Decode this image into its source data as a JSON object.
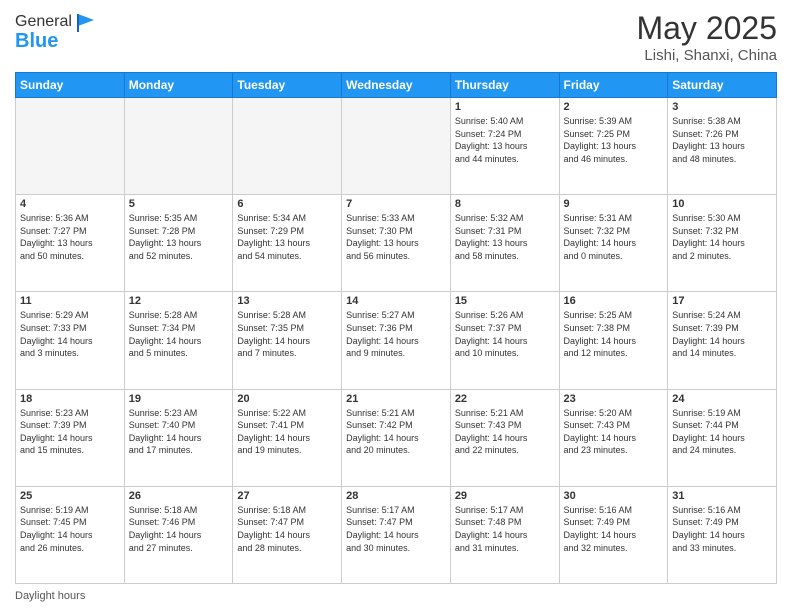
{
  "header": {
    "logo_general": "General",
    "logo_blue": "Blue",
    "month_title": "May 2025",
    "location": "Lishi, Shanxi, China"
  },
  "weekdays": [
    "Sunday",
    "Monday",
    "Tuesday",
    "Wednesday",
    "Thursday",
    "Friday",
    "Saturday"
  ],
  "weeks": [
    [
      {
        "day": "",
        "info": ""
      },
      {
        "day": "",
        "info": ""
      },
      {
        "day": "",
        "info": ""
      },
      {
        "day": "",
        "info": ""
      },
      {
        "day": "1",
        "info": "Sunrise: 5:40 AM\nSunset: 7:24 PM\nDaylight: 13 hours\nand 44 minutes."
      },
      {
        "day": "2",
        "info": "Sunrise: 5:39 AM\nSunset: 7:25 PM\nDaylight: 13 hours\nand 46 minutes."
      },
      {
        "day": "3",
        "info": "Sunrise: 5:38 AM\nSunset: 7:26 PM\nDaylight: 13 hours\nand 48 minutes."
      }
    ],
    [
      {
        "day": "4",
        "info": "Sunrise: 5:36 AM\nSunset: 7:27 PM\nDaylight: 13 hours\nand 50 minutes."
      },
      {
        "day": "5",
        "info": "Sunrise: 5:35 AM\nSunset: 7:28 PM\nDaylight: 13 hours\nand 52 minutes."
      },
      {
        "day": "6",
        "info": "Sunrise: 5:34 AM\nSunset: 7:29 PM\nDaylight: 13 hours\nand 54 minutes."
      },
      {
        "day": "7",
        "info": "Sunrise: 5:33 AM\nSunset: 7:30 PM\nDaylight: 13 hours\nand 56 minutes."
      },
      {
        "day": "8",
        "info": "Sunrise: 5:32 AM\nSunset: 7:31 PM\nDaylight: 13 hours\nand 58 minutes."
      },
      {
        "day": "9",
        "info": "Sunrise: 5:31 AM\nSunset: 7:32 PM\nDaylight: 14 hours\nand 0 minutes."
      },
      {
        "day": "10",
        "info": "Sunrise: 5:30 AM\nSunset: 7:32 PM\nDaylight: 14 hours\nand 2 minutes."
      }
    ],
    [
      {
        "day": "11",
        "info": "Sunrise: 5:29 AM\nSunset: 7:33 PM\nDaylight: 14 hours\nand 3 minutes."
      },
      {
        "day": "12",
        "info": "Sunrise: 5:28 AM\nSunset: 7:34 PM\nDaylight: 14 hours\nand 5 minutes."
      },
      {
        "day": "13",
        "info": "Sunrise: 5:28 AM\nSunset: 7:35 PM\nDaylight: 14 hours\nand 7 minutes."
      },
      {
        "day": "14",
        "info": "Sunrise: 5:27 AM\nSunset: 7:36 PM\nDaylight: 14 hours\nand 9 minutes."
      },
      {
        "day": "15",
        "info": "Sunrise: 5:26 AM\nSunset: 7:37 PM\nDaylight: 14 hours\nand 10 minutes."
      },
      {
        "day": "16",
        "info": "Sunrise: 5:25 AM\nSunset: 7:38 PM\nDaylight: 14 hours\nand 12 minutes."
      },
      {
        "day": "17",
        "info": "Sunrise: 5:24 AM\nSunset: 7:39 PM\nDaylight: 14 hours\nand 14 minutes."
      }
    ],
    [
      {
        "day": "18",
        "info": "Sunrise: 5:23 AM\nSunset: 7:39 PM\nDaylight: 14 hours\nand 15 minutes."
      },
      {
        "day": "19",
        "info": "Sunrise: 5:23 AM\nSunset: 7:40 PM\nDaylight: 14 hours\nand 17 minutes."
      },
      {
        "day": "20",
        "info": "Sunrise: 5:22 AM\nSunset: 7:41 PM\nDaylight: 14 hours\nand 19 minutes."
      },
      {
        "day": "21",
        "info": "Sunrise: 5:21 AM\nSunset: 7:42 PM\nDaylight: 14 hours\nand 20 minutes."
      },
      {
        "day": "22",
        "info": "Sunrise: 5:21 AM\nSunset: 7:43 PM\nDaylight: 14 hours\nand 22 minutes."
      },
      {
        "day": "23",
        "info": "Sunrise: 5:20 AM\nSunset: 7:43 PM\nDaylight: 14 hours\nand 23 minutes."
      },
      {
        "day": "24",
        "info": "Sunrise: 5:19 AM\nSunset: 7:44 PM\nDaylight: 14 hours\nand 24 minutes."
      }
    ],
    [
      {
        "day": "25",
        "info": "Sunrise: 5:19 AM\nSunset: 7:45 PM\nDaylight: 14 hours\nand 26 minutes."
      },
      {
        "day": "26",
        "info": "Sunrise: 5:18 AM\nSunset: 7:46 PM\nDaylight: 14 hours\nand 27 minutes."
      },
      {
        "day": "27",
        "info": "Sunrise: 5:18 AM\nSunset: 7:47 PM\nDaylight: 14 hours\nand 28 minutes."
      },
      {
        "day": "28",
        "info": "Sunrise: 5:17 AM\nSunset: 7:47 PM\nDaylight: 14 hours\nand 30 minutes."
      },
      {
        "day": "29",
        "info": "Sunrise: 5:17 AM\nSunset: 7:48 PM\nDaylight: 14 hours\nand 31 minutes."
      },
      {
        "day": "30",
        "info": "Sunrise: 5:16 AM\nSunset: 7:49 PM\nDaylight: 14 hours\nand 32 minutes."
      },
      {
        "day": "31",
        "info": "Sunrise: 5:16 AM\nSunset: 7:49 PM\nDaylight: 14 hours\nand 33 minutes."
      }
    ]
  ],
  "footer": {
    "daylight_hours": "Daylight hours"
  }
}
